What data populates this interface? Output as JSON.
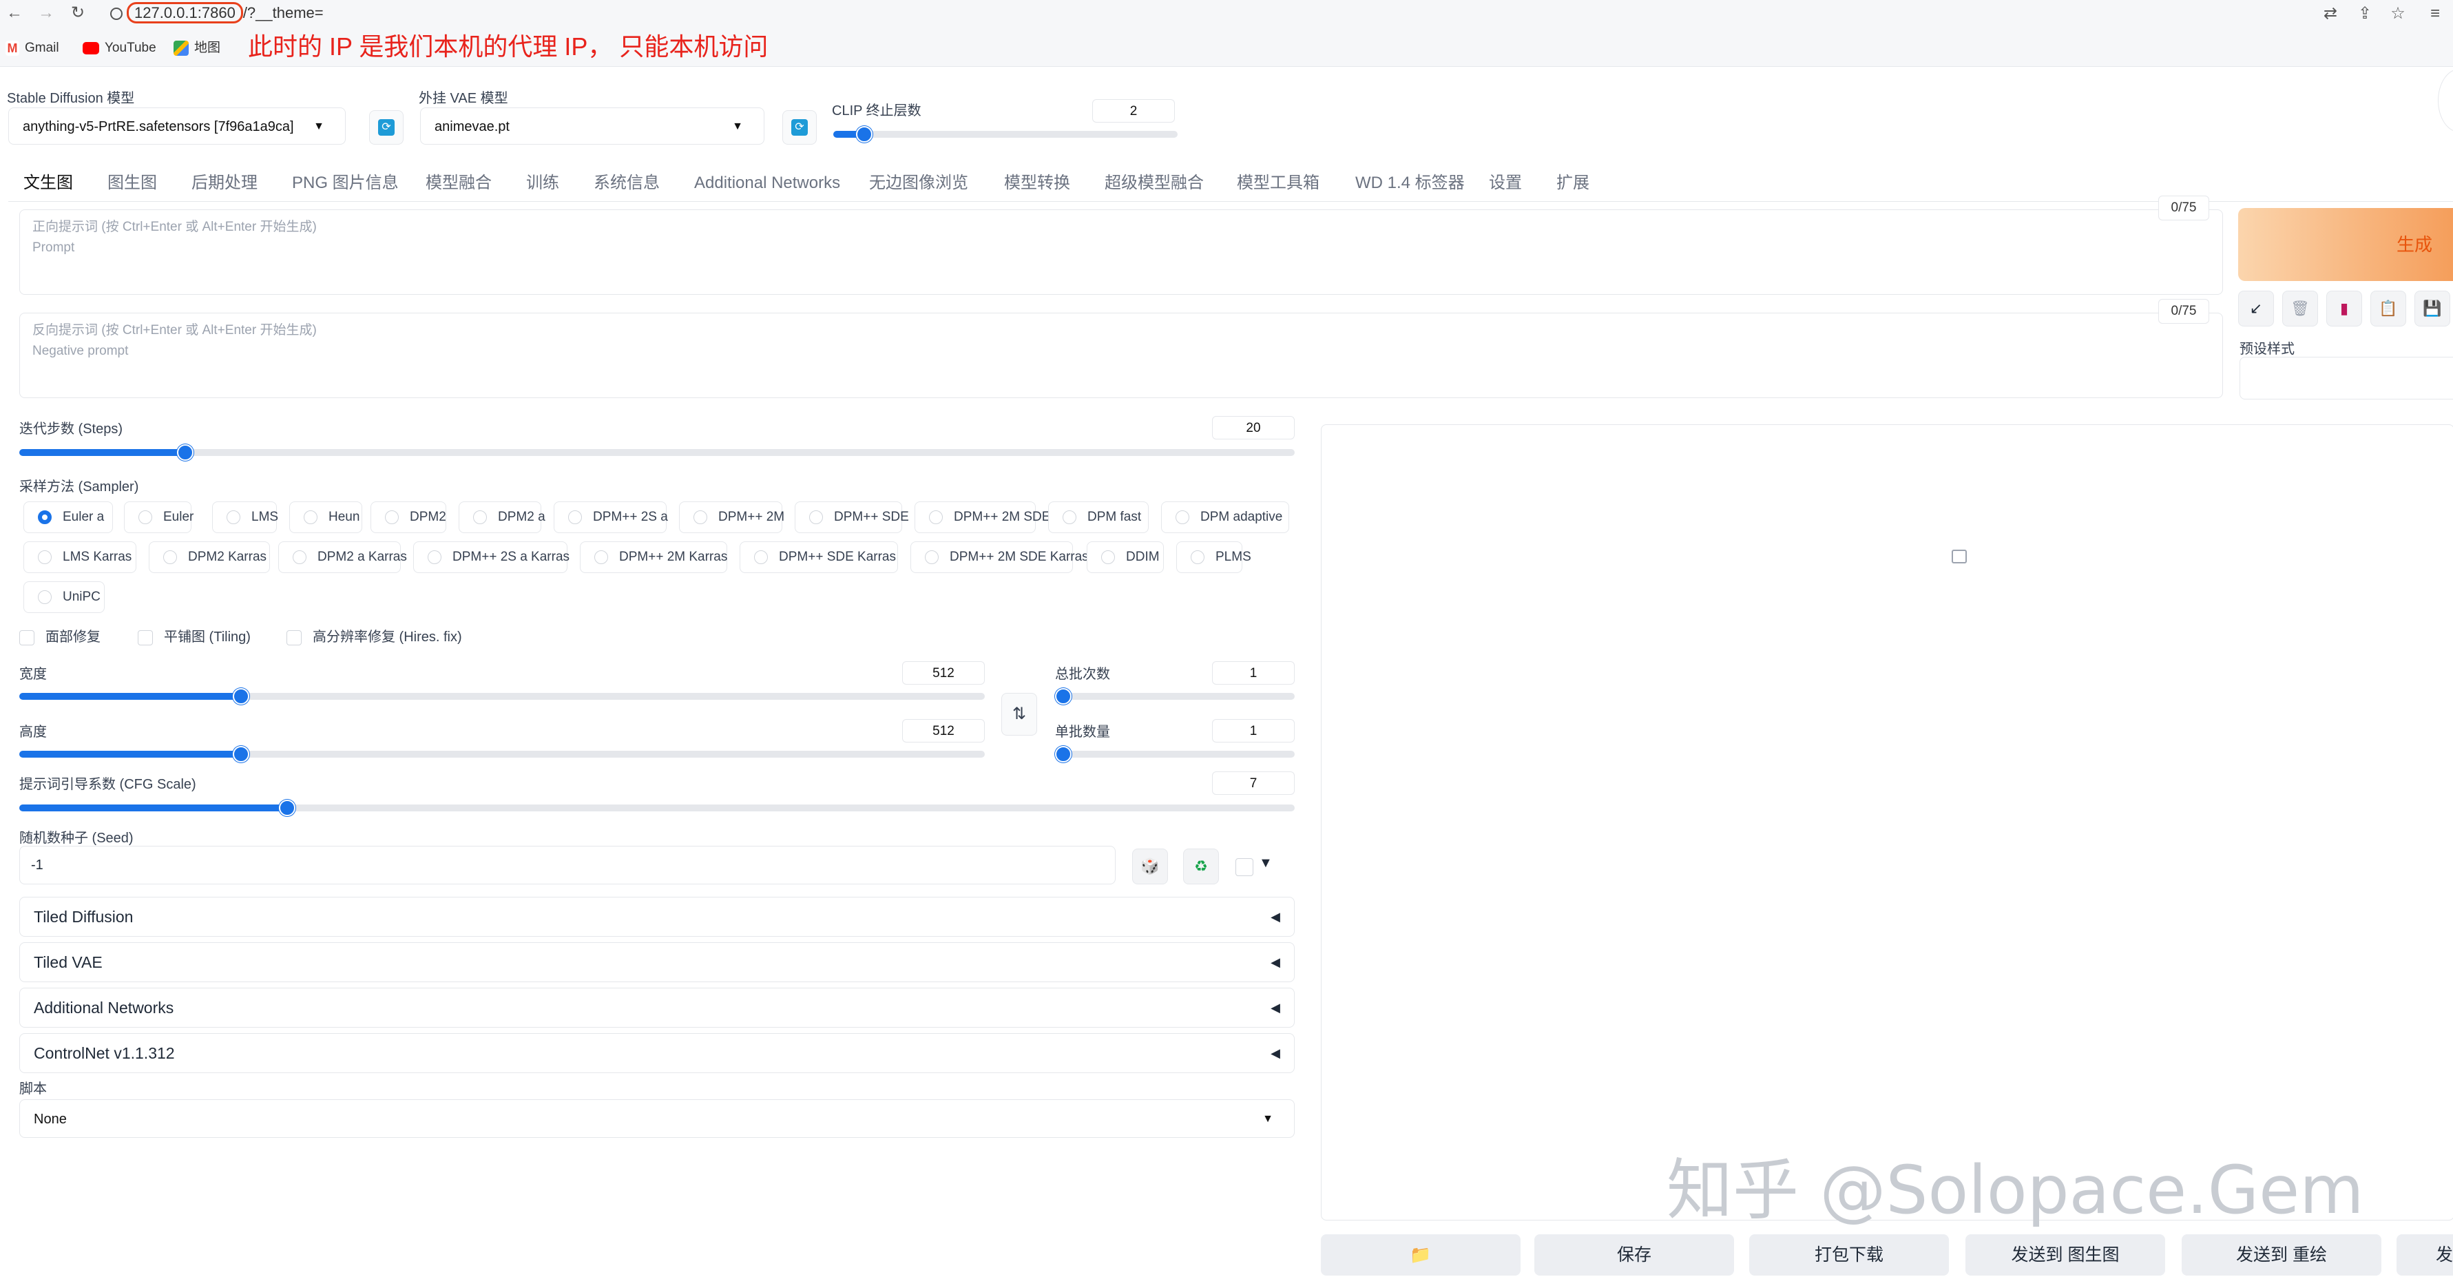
{
  "browser": {
    "url_host": "127.0.0.1:7860",
    "url_rest": "/?__theme=",
    "annotation": "此时的 IP 是我们本机的代理 IP， 只能本机访问",
    "bookmarks": [
      {
        "label": "Gmail"
      },
      {
        "label": "YouTube"
      },
      {
        "label": "地图"
      }
    ]
  },
  "models": {
    "sd_label": "Stable Diffusion 模型",
    "sd_value": "anything-v5-PrtRE.safetensors [7f96a1a9ca]",
    "vae_label": "外挂 VAE 模型",
    "vae_value": "animevae.pt",
    "clip_label": "CLIP 终止层数",
    "clip_value": "2",
    "clip_min": 1,
    "clip_max": 12
  },
  "tabs": [
    "文生图",
    "图生图",
    "后期处理",
    "PNG 图片信息",
    "模型融合",
    "训练",
    "系统信息",
    "Additional Networks",
    "无边图像浏览",
    "模型转换",
    "超级模型融合",
    "模型工具箱",
    "WD 1.4 标签器",
    "设置",
    "扩展"
  ],
  "active_tab": 0,
  "prompt": {
    "positive_hint": "正向提示词 (按 Ctrl+Enter 或 Alt+Enter 开始生成)",
    "positive_sub": "Prompt",
    "positive_count": "0/75",
    "negative_hint": "反向提示词 (按 Ctrl+Enter 或 Alt+Enter 开始生成)",
    "negative_sub": "Negative prompt",
    "negative_count": "0/75"
  },
  "generate_label": "生成",
  "styles_label": "预设样式",
  "steps": {
    "label": "迭代步数 (Steps)",
    "value": "20",
    "fraction": 0.13
  },
  "sampler": {
    "label": "采样方法 (Sampler)",
    "options": [
      "Euler a",
      "Euler",
      "LMS",
      "Heun",
      "DPM2",
      "DPM2 a",
      "DPM++ 2S a",
      "DPM++ 2M",
      "DPM++ SDE",
      "DPM++ 2M SDE",
      "DPM fast",
      "DPM adaptive",
      "LMS Karras",
      "DPM2 Karras",
      "DPM2 a Karras",
      "DPM++ 2S a Karras",
      "DPM++ 2M Karras",
      "DPM++ SDE Karras",
      "DPM++ 2M SDE Karras",
      "DDIM",
      "PLMS",
      "UniPC"
    ],
    "selected": 0
  },
  "checks": [
    "面部修复",
    "平铺图 (Tiling)",
    "高分辨率修复 (Hires. fix)"
  ],
  "width": {
    "label": "宽度",
    "value": "512",
    "fraction": 0.23
  },
  "height": {
    "label": "高度",
    "value": "512",
    "fraction": 0.23
  },
  "batch_count": {
    "label": "总批次数",
    "value": "1",
    "fraction": 0.0
  },
  "batch_size": {
    "label": "单批数量",
    "value": "1",
    "fraction": 0.0
  },
  "cfg": {
    "label": "提示词引导系数 (CFG Scale)",
    "value": "7",
    "fraction": 0.21
  },
  "seed": {
    "label": "随机数种子 (Seed)",
    "value": "-1"
  },
  "accordions": [
    "Tiled Diffusion",
    "Tiled VAE",
    "Additional Networks",
    "ControlNet v1.1.312"
  ],
  "script": {
    "label": "脚本",
    "value": "None"
  },
  "actions": [
    "保存",
    "打包下载",
    "发送到 图生图",
    "发送到 重绘",
    "发"
  ],
  "watermark": "知乎 @Solopace.Gem",
  "colors": {
    "accent": "#1a73e8",
    "generate": "#f59e5b",
    "annotation": "#e8231c"
  }
}
